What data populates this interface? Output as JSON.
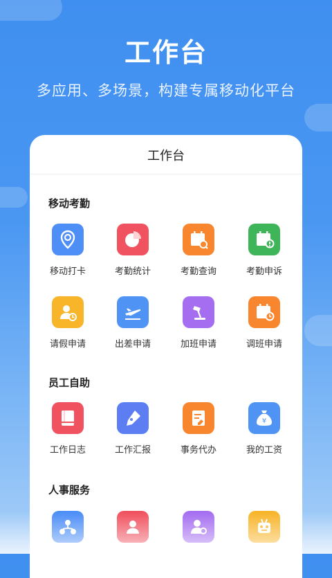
{
  "hero": {
    "title": "工作台",
    "subtitle": "多应用、多场景，构建专属移动化平台"
  },
  "card": {
    "title": "工作台",
    "sections": [
      {
        "title": "移动考勤",
        "items": [
          {
            "label": "移动打卡",
            "icon": "location-pin-icon",
            "color": "#4d8ef7"
          },
          {
            "label": "考勤统计",
            "icon": "pie-chart-icon",
            "color": "#f0525f"
          },
          {
            "label": "考勤查询",
            "icon": "calendar-search-icon",
            "color": "#f7862f"
          },
          {
            "label": "考勤申诉",
            "icon": "calendar-alert-icon",
            "color": "#3fb559"
          }
        ]
      },
      {
        "items": [
          {
            "label": "请假申请",
            "icon": "user-clock-icon",
            "color": "#f8b52a"
          },
          {
            "label": "出差申请",
            "icon": "airplane-icon",
            "color": "#4f94f4"
          },
          {
            "label": "加班申请",
            "icon": "desk-lamp-icon",
            "color": "#a56ef0"
          },
          {
            "label": "调班申请",
            "icon": "calendar-clock-icon",
            "color": "#f7862f"
          }
        ]
      },
      {
        "title": "员工自助",
        "items": [
          {
            "label": "工作日志",
            "icon": "book-icon",
            "color": "#f0525f"
          },
          {
            "label": "工作汇报",
            "icon": "pen-icon",
            "color": "#5c7ef2"
          },
          {
            "label": "事务代办",
            "icon": "document-edit-icon",
            "color": "#f7862f"
          },
          {
            "label": "我的工资",
            "icon": "money-bag-icon",
            "color": "#4f94f4"
          }
        ]
      },
      {
        "title": "人事服务",
        "items": [
          {
            "label": "",
            "icon": "org-chart-icon",
            "color": "#4d8ef7"
          },
          {
            "label": "",
            "icon": "user-card-icon",
            "color": "#f0525f"
          },
          {
            "label": "",
            "icon": "user-search-icon",
            "color": "#a56ef0"
          },
          {
            "label": "",
            "icon": "robot-icon",
            "color": "#f8b52a"
          }
        ]
      }
    ]
  }
}
